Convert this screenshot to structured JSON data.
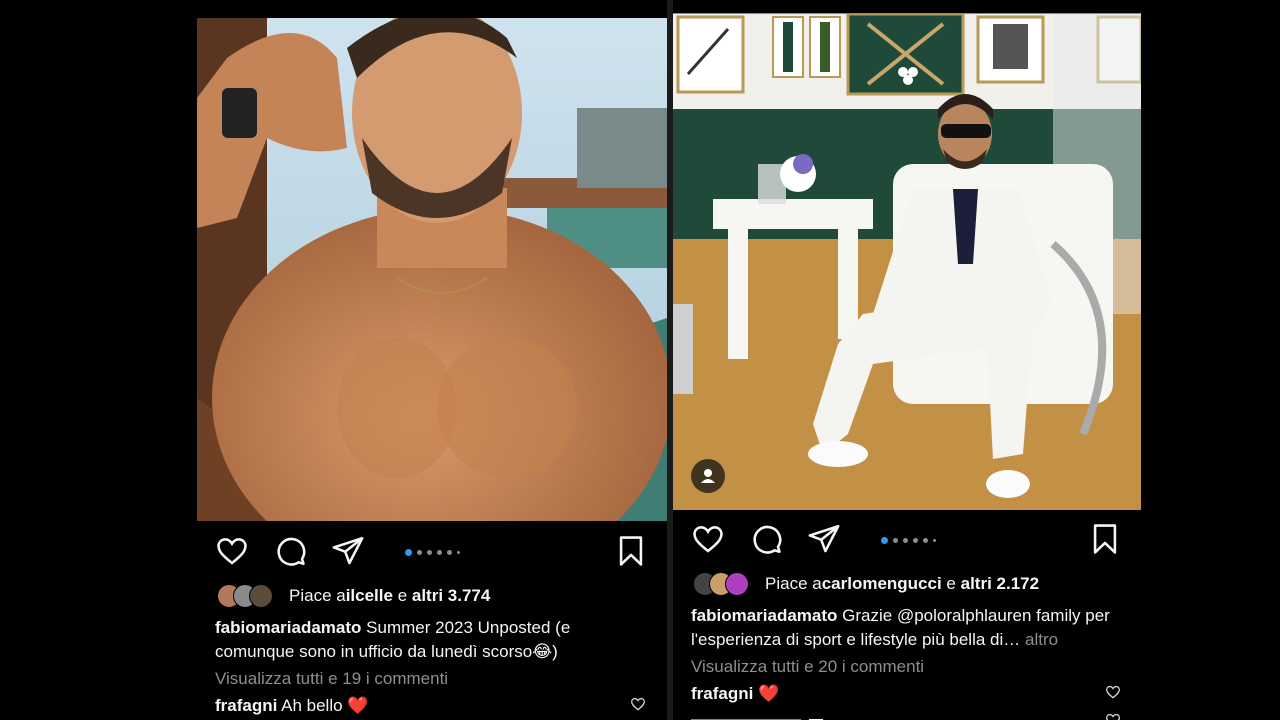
{
  "posts": [
    {
      "likes": {
        "prefix": "Piace a ",
        "user": "ilcelle",
        "middle": " e ",
        "count": "altri 3.774"
      },
      "caption": {
        "user": "fabiomariadamato",
        "text": " Summer 2023 Unposted (e comunque sono in ufficio da lunedì scorso😂)",
        "more": ""
      },
      "view_all": "Visualizza tutti e 19 i commenti",
      "comment": {
        "user": "frafagni",
        "text": " Ah bello ❤️"
      },
      "avatar_colors": [
        "#b07a5a",
        "#8a8a8a",
        "#5c4a3a"
      ]
    },
    {
      "likes": {
        "prefix": "Piace a ",
        "user": "carlomengucci",
        "middle": " e ",
        "count": "altri 2.172"
      },
      "caption": {
        "user": "fabiomariadamato",
        "text": " Grazie @poloralphlauren family per l'esperienza di sport e lifestyle più bella di…",
        "more": " altro"
      },
      "view_all": "Visualizza tutti e 20 i commenti",
      "comment": {
        "user": "frafagni",
        "text": " ❤️"
      },
      "avatar_colors": [
        "#444444",
        "#c9a06a",
        "#b03fc0"
      ]
    }
  ],
  "icons": [
    "heart-icon",
    "comment-icon",
    "share-icon",
    "bookmark-icon",
    "user-tag-icon"
  ],
  "colors": {
    "bg": "#000000",
    "text": "#f5f5f5",
    "muted": "#8e8e8e",
    "carousel_active": "#3897f0",
    "like_red": "#ed4956"
  }
}
